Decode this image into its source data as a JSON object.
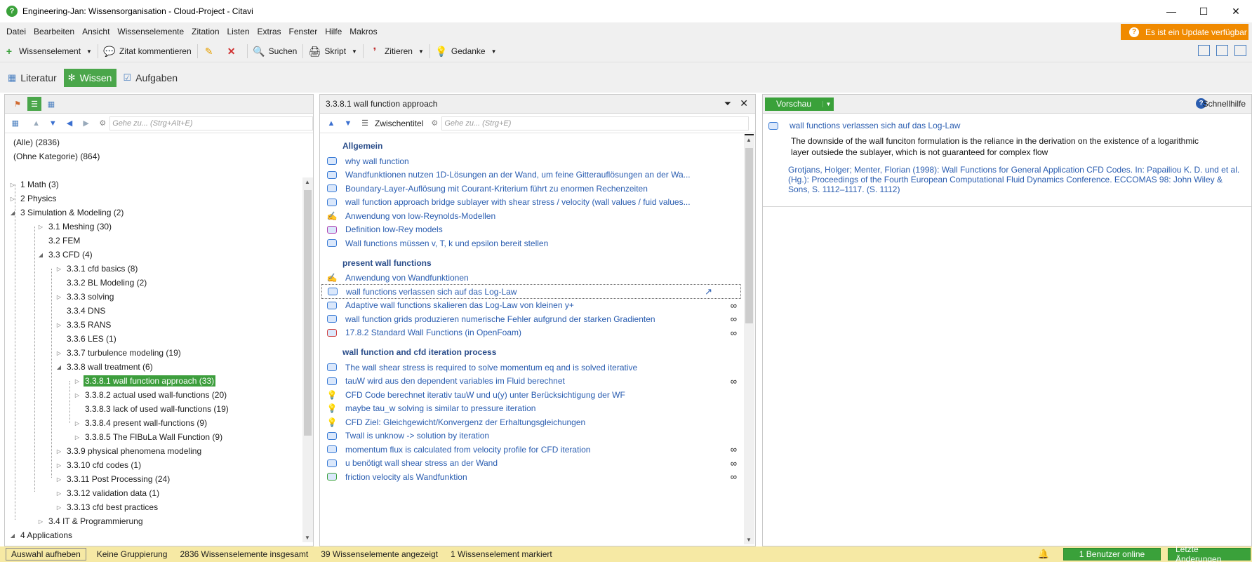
{
  "window": {
    "title": "Engineering-Jan: Wissensorganisation - Cloud-Project - Citavi"
  },
  "menu": [
    "Datei",
    "Bearbeiten",
    "Ansicht",
    "Wissenselemente",
    "Zitation",
    "Listen",
    "Extras",
    "Fenster",
    "Hilfe",
    "Makros"
  ],
  "update": {
    "label": "Es ist ein Update verfügbar"
  },
  "toolbar": {
    "wissenselement": "Wissenselement",
    "zitat": "Zitat kommentieren",
    "suchen": "Suchen",
    "skript": "Skript",
    "zitieren": "Zitieren",
    "gedanke": "Gedanke"
  },
  "tabs": [
    {
      "label": "Literatur"
    },
    {
      "label": "Wissen"
    },
    {
      "label": "Aufgaben"
    }
  ],
  "left": {
    "search_placeholder": "Gehe zu... (Strg+Alt+E)",
    "tree": [
      {
        "label": "(Alle) (2836)",
        "depth": 0,
        "tri": ""
      },
      {
        "label": "(Ohne Kategorie) (864)",
        "depth": 0,
        "tri": ""
      },
      {
        "label": "",
        "depth": 0,
        "tri": ""
      },
      {
        "label": "1 Math (3)",
        "depth": 0,
        "tri": "▷"
      },
      {
        "label": "2 Physics",
        "depth": 0,
        "tri": "▷"
      },
      {
        "label": "3 Simulation & Modeling (2)",
        "depth": 0,
        "tri": "◢"
      },
      {
        "label": "3.1 Meshing (30)",
        "depth": 1,
        "tri": "▷"
      },
      {
        "label": "3.2 FEM",
        "depth": 1,
        "tri": ""
      },
      {
        "label": "3.3 CFD (4)",
        "depth": 1,
        "tri": "◢"
      },
      {
        "label": "3.3.1 cfd basics (8)",
        "depth": 2,
        "tri": "▷"
      },
      {
        "label": "3.3.2 BL Modeling (2)",
        "depth": 2,
        "tri": ""
      },
      {
        "label": "3.3.3 solving",
        "depth": 2,
        "tri": "▷"
      },
      {
        "label": "3.3.4 DNS",
        "depth": 2,
        "tri": ""
      },
      {
        "label": "3.3.5 RANS",
        "depth": 2,
        "tri": "▷"
      },
      {
        "label": "3.3.6 LES (1)",
        "depth": 2,
        "tri": ""
      },
      {
        "label": "3.3.7 turbulence modeling (19)",
        "depth": 2,
        "tri": "▷"
      },
      {
        "label": "3.3.8 wall treatment (6)",
        "depth": 2,
        "tri": "◢"
      },
      {
        "label": "3.3.8.1 wall function approach (33)",
        "depth": 3,
        "tri": "▷",
        "selected": true
      },
      {
        "label": "3.3.8.2 actual used wall-functions (20)",
        "depth": 3,
        "tri": "▷"
      },
      {
        "label": "3.3.8.3 lack of used wall-functions (19)",
        "depth": 3,
        "tri": ""
      },
      {
        "label": "3.3.8.4 present wall-functions (9)",
        "depth": 3,
        "tri": "▷"
      },
      {
        "label": "3.3.8.5 The FIBuLa Wall Function (9)",
        "depth": 3,
        "tri": "▷"
      },
      {
        "label": "3.3.9 physical phenomena modeling",
        "depth": 2,
        "tri": "▷"
      },
      {
        "label": "3.3.10 cfd codes (1)",
        "depth": 2,
        "tri": "▷"
      },
      {
        "label": "3.3.11 Post Processing (24)",
        "depth": 2,
        "tri": "▷"
      },
      {
        "label": "3.3.12 validation data (1)",
        "depth": 2,
        "tri": "▷"
      },
      {
        "label": "3.3.13 cfd best practices",
        "depth": 2,
        "tri": "▷"
      },
      {
        "label": "3.4 IT & Programmierung",
        "depth": 1,
        "tri": "▷"
      },
      {
        "label": "4 Applications",
        "depth": 0,
        "tri": "◢"
      }
    ]
  },
  "middle": {
    "title": "3.3.8.1 wall function approach",
    "zwischentitel": "Zwischentitel",
    "search_placeholder": "Gehe zu... (Strg+E)",
    "groups": [
      {
        "title": "Allgemein",
        "items": [
          {
            "text": "why wall function",
            "icon": "comment",
            "link": false
          },
          {
            "text": "Wandfunktionen nutzen 1D-Lösungen an der Wand, um feine Gitterauflösungen an der Wa...",
            "icon": "comment",
            "link": false
          },
          {
            "text": "Boundary-Layer-Auflösung mit Courant-Kriterium führt zu enormen Rechenzeiten",
            "icon": "comment",
            "link": false
          },
          {
            "text": "wall function approach bridge sublayer with shear stress / velocity (wall values / fuid values...",
            "icon": "comment",
            "link": false
          },
          {
            "text": "Anwendung von low-Reynolds-Modellen",
            "icon": "hand",
            "link": false
          },
          {
            "text": "Definition low-Rey models",
            "icon": "comment-purple",
            "link": false
          },
          {
            "text": "Wall functions müssen v, T, k und epsilon bereit stellen",
            "icon": "comment",
            "link": false
          }
        ]
      },
      {
        "title": "present wall functions",
        "items": [
          {
            "text": "Anwendung von Wandfunktionen",
            "icon": "hand",
            "link": false
          },
          {
            "text": "wall functions verlassen sich auf das Log-Law",
            "icon": "comment",
            "link": false,
            "selected": true
          },
          {
            "text": "Adaptive wall functions skalieren das Log-Law von kleinen y+",
            "icon": "comment",
            "link": true
          },
          {
            "text": "wall function grids produzieren numerische Fehler aufgrund der starken Gradienten",
            "icon": "comment",
            "link": true
          },
          {
            "text": "17.8.2 Standard Wall Functions (in OpenFoam)",
            "icon": "comment-red",
            "link": true
          }
        ]
      },
      {
        "title": "wall function and cfd iteration process",
        "items": [
          {
            "text": "The wall shear stress is required to solve momentum eq and is solved iterative",
            "icon": "comment",
            "link": false
          },
          {
            "text": "tauW wird aus den dependent variables im Fluid berechnet",
            "icon": "comment",
            "link": true
          },
          {
            "text": "CFD Code berechnet iterativ tauW und u(y) unter Berücksichtigung der WF",
            "icon": "bulb",
            "link": false
          },
          {
            "text": "maybe tau_w solving is similar to pressure iteration",
            "icon": "bulb",
            "link": false
          },
          {
            "text": "CFD Ziel: Gleichgewicht/Konvergenz der Erhaltungsgleichungen",
            "icon": "bulb",
            "link": false
          },
          {
            "text": "Twall is unknow -> solution by iteration",
            "icon": "comment",
            "link": false
          },
          {
            "text": "momentum flux is calculated from velocity profile for CFD iteration",
            "icon": "comment",
            "link": true
          },
          {
            "text": "u benötigt wall shear stress an der Wand",
            "icon": "comment",
            "link": true
          },
          {
            "text": "friction velocity als Wandfunktion",
            "icon": "comment-green",
            "link": true
          }
        ]
      }
    ]
  },
  "right": {
    "vorschau": "Vorschau",
    "help": "Schnellhilfe",
    "preview_title": "wall functions verlassen sich auf das Log-Law",
    "preview_text": "The downside of the wall funciton formulation is the reliance in the derivation on the existence of a logarithmic layer outsiede the sublayer, which is not guaranteed for complex flow",
    "citation": "Grotjans, Holger; Menter, Florian (1998): Wall Functions for General Application CFD Codes. In: Papailiou K. D. und et al. (Hg.): Proceedings of the Fourth European Computational Fluid Dynamics Conference. ECCOMAS 98: John Wiley & Sons, S. 1112–1117. (S. 1112)"
  },
  "status": {
    "auswahl": "Auswahl aufheben",
    "gruppierung": "Keine Gruppierung",
    "total": "2836 Wissenselemente insgesamt",
    "shown": "39 Wissenselemente angezeigt",
    "marked": "1 Wissenselement markiert",
    "online": "1 Benutzer online",
    "changes": "Letzte Änderungen"
  },
  "colors": {
    "green": "#3aa13a",
    "orange": "#f08a00",
    "link": "#2a5db0",
    "status": "#f6e9a4"
  }
}
